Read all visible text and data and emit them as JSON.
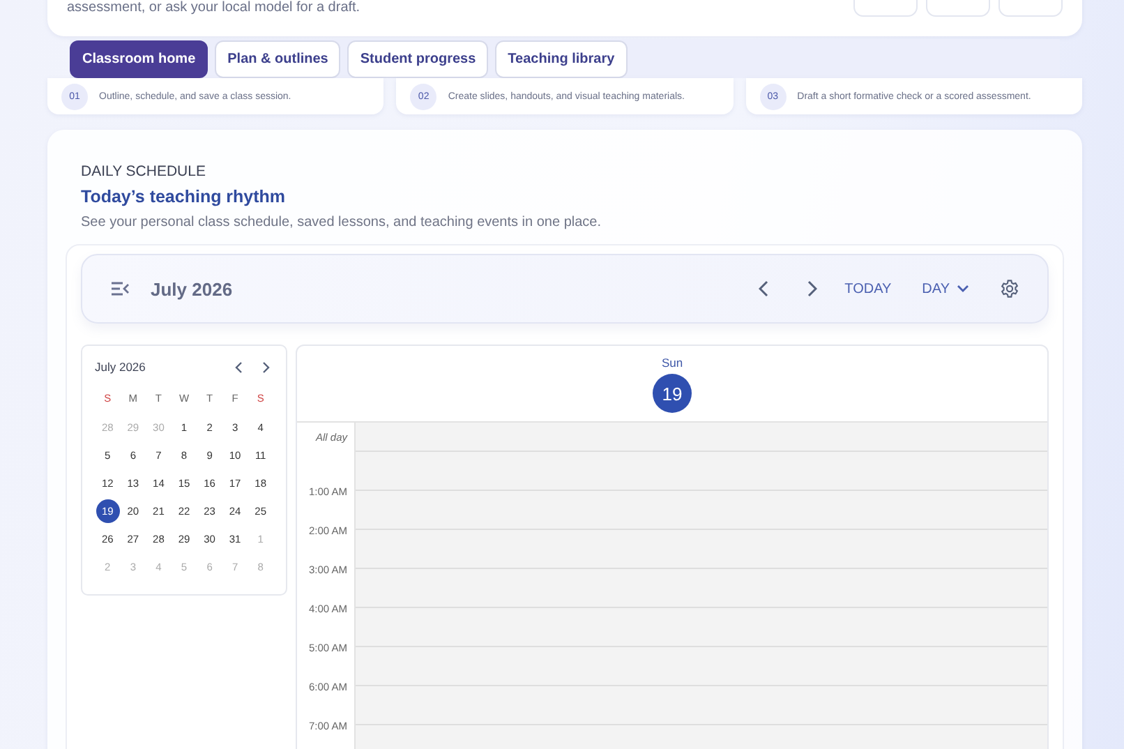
{
  "intro_card": {
    "text": "assessment, or ask your local model for a draft."
  },
  "tabs": [
    {
      "label": "Classroom home",
      "selected": true
    },
    {
      "label": "Plan & outlines",
      "selected": false
    },
    {
      "label": "Student progress",
      "selected": false
    },
    {
      "label": "Teaching library",
      "selected": false
    }
  ],
  "tools": [
    {
      "number": "01",
      "description": "Outline, schedule, and save a class session."
    },
    {
      "number": "02",
      "description": "Create slides, handouts, and visual teaching materials."
    },
    {
      "number": "03",
      "description": "Draft a short formative check or a scored assessment."
    }
  ],
  "schedule": {
    "eyebrow": "DAILY SCHEDULE",
    "title": "Today’s teaching rhythm",
    "description": "See your personal class schedule, saved lessons, and teaching events in one place.",
    "toolbar": {
      "title": "July 2026",
      "today": "TODAY",
      "view": "DAY"
    },
    "mini_calendar": {
      "title": "July 2026",
      "weekdays": [
        {
          "label": "S",
          "weekend": true
        },
        {
          "label": "M",
          "weekend": false
        },
        {
          "label": "T",
          "weekend": false
        },
        {
          "label": "W",
          "weekend": false
        },
        {
          "label": "T",
          "weekend": false
        },
        {
          "label": "F",
          "weekend": false
        },
        {
          "label": "S",
          "weekend": true
        }
      ],
      "weeks": [
        [
          {
            "day": "28",
            "muted": true,
            "selected": false
          },
          {
            "day": "29",
            "muted": true,
            "selected": false
          },
          {
            "day": "30",
            "muted": true,
            "selected": false
          },
          {
            "day": "1",
            "muted": false,
            "selected": false
          },
          {
            "day": "2",
            "muted": false,
            "selected": false
          },
          {
            "day": "3",
            "muted": false,
            "selected": false
          },
          {
            "day": "4",
            "muted": false,
            "selected": false
          }
        ],
        [
          {
            "day": "5",
            "muted": false,
            "selected": false
          },
          {
            "day": "6",
            "muted": false,
            "selected": false
          },
          {
            "day": "7",
            "muted": false,
            "selected": false
          },
          {
            "day": "8",
            "muted": false,
            "selected": false
          },
          {
            "day": "9",
            "muted": false,
            "selected": false
          },
          {
            "day": "10",
            "muted": false,
            "selected": false
          },
          {
            "day": "11",
            "muted": false,
            "selected": false
          }
        ],
        [
          {
            "day": "12",
            "muted": false,
            "selected": false
          },
          {
            "day": "13",
            "muted": false,
            "selected": false
          },
          {
            "day": "14",
            "muted": false,
            "selected": false
          },
          {
            "day": "15",
            "muted": false,
            "selected": false
          },
          {
            "day": "16",
            "muted": false,
            "selected": false
          },
          {
            "day": "17",
            "muted": false,
            "selected": false
          },
          {
            "day": "18",
            "muted": false,
            "selected": false
          }
        ],
        [
          {
            "day": "19",
            "muted": false,
            "selected": true
          },
          {
            "day": "20",
            "muted": false,
            "selected": false
          },
          {
            "day": "21",
            "muted": false,
            "selected": false
          },
          {
            "day": "22",
            "muted": false,
            "selected": false
          },
          {
            "day": "23",
            "muted": false,
            "selected": false
          },
          {
            "day": "24",
            "muted": false,
            "selected": false
          },
          {
            "day": "25",
            "muted": false,
            "selected": false
          }
        ],
        [
          {
            "day": "26",
            "muted": false,
            "selected": false
          },
          {
            "day": "27",
            "muted": false,
            "selected": false
          },
          {
            "day": "28",
            "muted": false,
            "selected": false
          },
          {
            "day": "29",
            "muted": false,
            "selected": false
          },
          {
            "day": "30",
            "muted": false,
            "selected": false
          },
          {
            "day": "31",
            "muted": false,
            "selected": false
          },
          {
            "day": "1",
            "muted": true,
            "selected": false
          }
        ],
        [
          {
            "day": "2",
            "muted": true,
            "selected": false
          },
          {
            "day": "3",
            "muted": true,
            "selected": false
          },
          {
            "day": "4",
            "muted": true,
            "selected": false
          },
          {
            "day": "5",
            "muted": true,
            "selected": false
          },
          {
            "day": "6",
            "muted": true,
            "selected": false
          },
          {
            "day": "7",
            "muted": true,
            "selected": false
          },
          {
            "day": "8",
            "muted": true,
            "selected": false
          }
        ]
      ]
    },
    "day_view": {
      "weekday": "Sun",
      "date": "19",
      "all_day": "All day",
      "hours": [
        "1:00 AM",
        "2:00 AM",
        "3:00 AM",
        "4:00 AM",
        "5:00 AM",
        "6:00 AM",
        "7:00 AM"
      ]
    }
  }
}
